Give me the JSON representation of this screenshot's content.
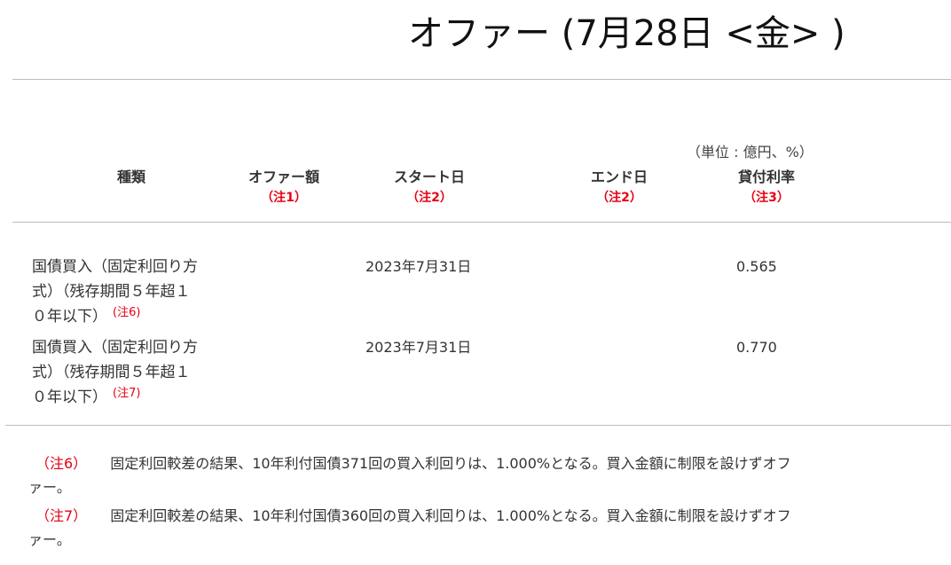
{
  "title": "オファー (7月28日 <金> )",
  "unit_note": "（単位 : 億円、%）",
  "table": {
    "headers": [
      {
        "label": "種類",
        "note": ""
      },
      {
        "label": "オファー額",
        "note": "（注1）"
      },
      {
        "label": "スタート日",
        "note": "（注2）"
      },
      {
        "label": "エンド日",
        "note": "（注2）"
      },
      {
        "label": "貸付利率",
        "note": "（注3）"
      }
    ],
    "rows": [
      {
        "type_line1": "国債買入（固定利回り方",
        "type_line2": "式）（残存期間５年超１",
        "type_line3": "０年以下）",
        "note": "(注6)",
        "offer_amount": "",
        "start_date": "2023年7月31日",
        "end_date": "",
        "rate": "0.565"
      },
      {
        "type_line1": "国債買入（固定利回り方",
        "type_line2": "式）（残存期間５年超１",
        "type_line3": "０年以下）",
        "note": "(注7)",
        "offer_amount": "",
        "start_date": "2023年7月31日",
        "end_date": "",
        "rate": "0.770"
      }
    ]
  },
  "footnotes": [
    {
      "label": "（注6）",
      "text": "固定利回較差の結果、10年利付国債371回の買入利回りは、1.000%となる。買入金額に制限を設けずオファー。"
    },
    {
      "label": "（注7）",
      "text": "固定利回較差の結果、10年利付国債360回の買入利回りは、1.000%となる。買入金額に制限を設けずオファー。"
    }
  ]
}
